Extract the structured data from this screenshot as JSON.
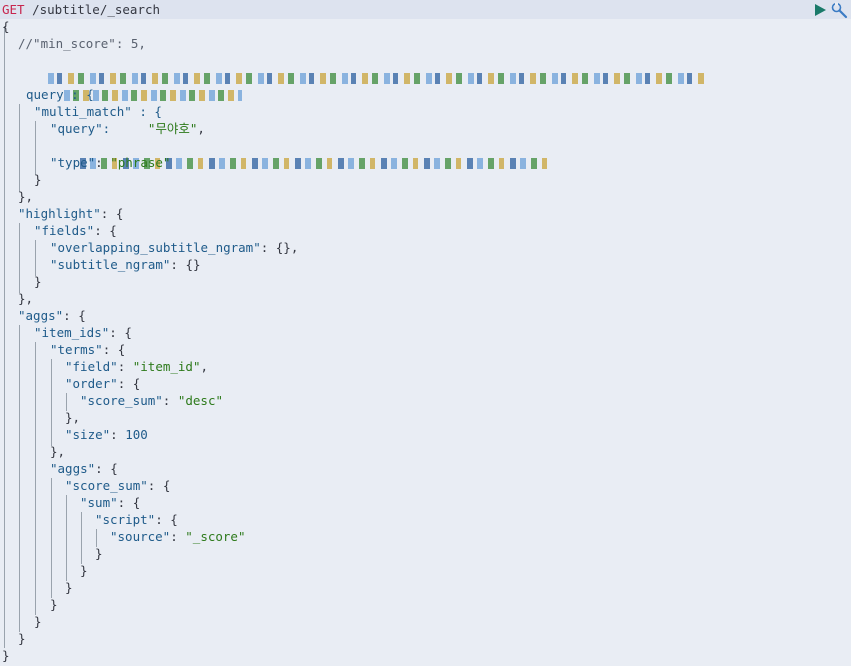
{
  "request": {
    "method": "GET",
    "path": " /subtitle/_search"
  },
  "icons": {
    "run": "play-icon",
    "settings": "wrench-icon"
  },
  "colors": {
    "method": "#c7254e",
    "key": "#1f5b8a",
    "string": "#2d7a1b",
    "background": "#e9edf4",
    "request_bar": "#dde3ef"
  },
  "body": {
    "l01": "{",
    "l02": "//\"min_score\": 5,",
    "l04": "query : {",
    "l05": "\"multi_match\" : {",
    "l06k": "\"query\":",
    "l06v": "\"무야호\"",
    "l08k": "\"type\"",
    "l08v": "\"phrase\"",
    "l09": "}",
    "l10": "},",
    "l11k": "\"highlight\"",
    "l11p": ": {",
    "l12k": "\"fields\"",
    "l12p": ": {",
    "l13k": "\"overlapping_subtitle_ngram\"",
    "l13p": ": {},",
    "l14k": "\"subtitle_ngram\"",
    "l14p": ": {}",
    "l15": "}",
    "l16": "},",
    "l17k": "\"aggs\"",
    "l17p": ": {",
    "l18k": "\"item_ids\"",
    "l18p": ": {",
    "l19k": "\"terms\"",
    "l19p": ": {",
    "l20k": "\"field\"",
    "l20v": "\"item_id\"",
    "l21k": "\"order\"",
    "l21p": ": {",
    "l22k": "\"score_sum\"",
    "l22v": "\"desc\"",
    "l23": "},",
    "l24k": "\"size\"",
    "l24v": "100",
    "l25": "},",
    "l26k": "\"aggs\"",
    "l26p": ": {",
    "l27k": "\"score_sum\"",
    "l27p": ": {",
    "l28k": "\"sum\"",
    "l28p": ": {",
    "l29k": "\"script\"",
    "l29p": ": {",
    "l30k": "\"source\"",
    "l30v": "\"_score\"",
    "l31": "}",
    "l32": "}",
    "l33": "}",
    "l34": "}",
    "l35": "}",
    "l36": "}",
    "l37": "}"
  }
}
